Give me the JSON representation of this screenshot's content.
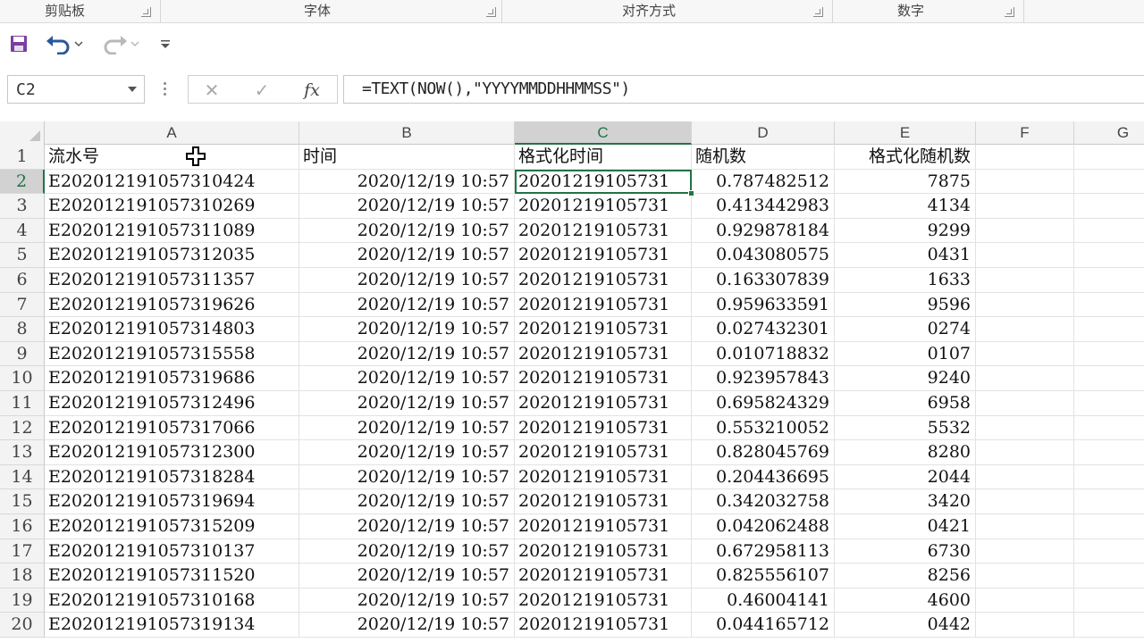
{
  "ribbon": {
    "groups": [
      {
        "label": "剪贴板"
      },
      {
        "label": "字体"
      },
      {
        "label": "对齐方式"
      },
      {
        "label": "数字"
      }
    ]
  },
  "quick_access": {
    "icons": [
      "save-icon",
      "undo-icon",
      "redo-icon",
      "customize-qat-icon"
    ]
  },
  "formula_bar": {
    "name_box": "C2",
    "cancel_symbol": "✕",
    "enter_symbol": "✓",
    "fx_label": "fx",
    "formula": "=TEXT(NOW(),\"YYYYMMDDHHMMSS\")"
  },
  "sheet": {
    "columns": [
      "A",
      "B",
      "C",
      "D",
      "E",
      "F",
      "G"
    ],
    "selected_cell": "C2",
    "headers": [
      "流水号",
      "时间",
      "格式化时间",
      "随机数",
      "格式化随机数"
    ],
    "rows": [
      {
        "n": "2",
        "a": "E20201219105731 0424",
        "b": "2020/12/19  10:57",
        "c": "20201219105731",
        "d": "0.787482512",
        "e": "7875"
      },
      {
        "n": "3",
        "a": "E20201219105731 0269",
        "b": "2020/12/19  10:57",
        "c": "20201219105731",
        "d": "0.413442983",
        "e": "4134"
      },
      {
        "n": "4",
        "a": "E20201219105731 1089",
        "b": "2020/12/19  10:57",
        "c": "20201219105731",
        "d": "0.929878184",
        "e": "9299"
      },
      {
        "n": "5",
        "a": "E20201219105731 2035",
        "b": "2020/12/19  10:57",
        "c": "20201219105731",
        "d": "0.043080575",
        "e": "0431"
      },
      {
        "n": "6",
        "a": "E20201219105731 1357",
        "b": "2020/12/19  10:57",
        "c": "20201219105731",
        "d": "0.163307839",
        "e": "1633"
      },
      {
        "n": "7",
        "a": "E20201219105731 9626",
        "b": "2020/12/19  10:57",
        "c": "20201219105731",
        "d": "0.959633591",
        "e": "9596"
      },
      {
        "n": "8",
        "a": "E20201219105731 4803",
        "b": "2020/12/19  10:57",
        "c": "20201219105731",
        "d": "0.027432301",
        "e": "0274"
      },
      {
        "n": "9",
        "a": "E20201219105731 5558",
        "b": "2020/12/19  10:57",
        "c": "20201219105731",
        "d": "0.010718832",
        "e": "0107"
      },
      {
        "n": "10",
        "a": "E20201219105731 9686",
        "b": "2020/12/19  10:57",
        "c": "20201219105731",
        "d": "0.923957843",
        "e": "9240"
      },
      {
        "n": "11",
        "a": "E20201219105731 2496",
        "b": "2020/12/19  10:57",
        "c": "20201219105731",
        "d": "0.695824329",
        "e": "6958"
      },
      {
        "n": "12",
        "a": "E20201219105731 7066",
        "b": "2020/12/19  10:57",
        "c": "20201219105731",
        "d": "0.553210052",
        "e": "5532"
      },
      {
        "n": "13",
        "a": "E20201219105731 2300",
        "b": "2020/12/19  10:57",
        "c": "20201219105731",
        "d": "0.828045769",
        "e": "8280"
      },
      {
        "n": "14",
        "a": "E20201219105731 8284",
        "b": "2020/12/19  10:57",
        "c": "20201219105731",
        "d": "0.204436695",
        "e": "2044"
      },
      {
        "n": "15",
        "a": "E20201219105731 9694",
        "b": "2020/12/19  10:57",
        "c": "20201219105731",
        "d": "0.342032758",
        "e": "3420"
      },
      {
        "n": "16",
        "a": "E20201219105731 5209",
        "b": "2020/12/19  10:57",
        "c": "20201219105731",
        "d": "0.042062488",
        "e": "0421"
      },
      {
        "n": "17",
        "a": "E20201219105731 0137",
        "b": "2020/12/19  10:57",
        "c": "20201219105731",
        "d": "0.672958113",
        "e": "6730"
      },
      {
        "n": "18",
        "a": "E20201219105731 1520",
        "b": "2020/12/19  10:57",
        "c": "20201219105731",
        "d": "0.825556107",
        "e": "8256"
      },
      {
        "n": "19",
        "a": "E20201219105731 0168",
        "b": "2020/12/19  10:57",
        "c": "20201219105731",
        "d": "0.46004141",
        "e": "4600"
      },
      {
        "n": "20",
        "a": "E20201219105731 9134",
        "b": "2020/12/19  10:57",
        "c": "20201219105731",
        "d": "0.044165712",
        "e": "0442"
      }
    ]
  },
  "colors": {
    "accent": "#217346",
    "save": "#7a3fa0",
    "undo": "#2b579a"
  }
}
